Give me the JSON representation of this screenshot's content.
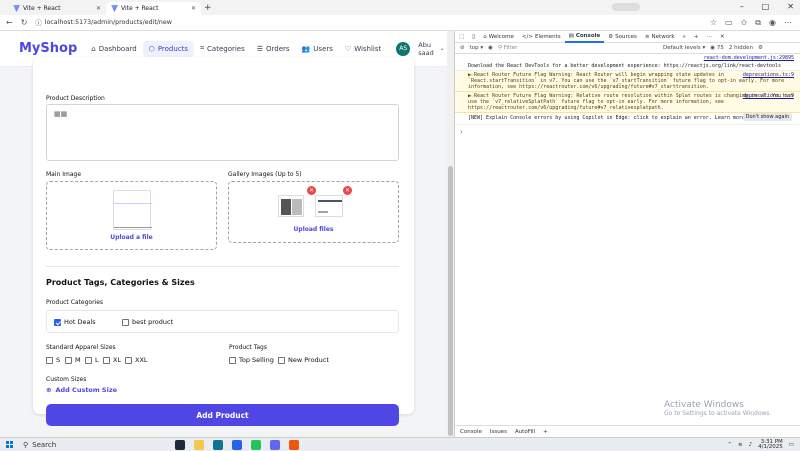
{
  "browser": {
    "tabs": [
      {
        "label": "Vite + React"
      },
      {
        "label": "Vite + React"
      }
    ],
    "url": "localhost:5173/admin/products/edit/new"
  },
  "app": {
    "brand": "MyShop",
    "nav": [
      "Dashboard",
      "Products",
      "Categories",
      "Orders",
      "Users",
      "Wishlist"
    ],
    "user": {
      "initials": "AS",
      "name_line1": "Abu",
      "name_line2": "saad"
    }
  },
  "form": {
    "description_label": "Product Description",
    "description_value": "▦▦",
    "main_image_label": "Main Image",
    "main_image_upload": "Upload a file",
    "gallery_label": "Gallery Images (Up to 5)",
    "gallery_upload": "Upload files",
    "section_title": "Product Tags, Categories & Sizes",
    "categories_label": "Product Categories",
    "categories": [
      {
        "label": "Hot Deals",
        "checked": true
      },
      {
        "label": "best product",
        "checked": false
      }
    ],
    "sizes_label": "Standard Apparel Sizes",
    "sizes": [
      "S",
      "M",
      "L",
      "XL",
      "XXL"
    ],
    "tags_label": "Product Tags",
    "tags": [
      "Top Selling",
      "New Product"
    ],
    "custom_sizes_label": "Custom Sizes",
    "add_custom_size": "Add Custom Size",
    "submit": "Add Product"
  },
  "devtools": {
    "tabs": [
      "Welcome",
      "Elements",
      "Console",
      "Sources",
      "Network"
    ],
    "context": "top",
    "filter_placeholder": "Filter",
    "levels": "Default levels",
    "issues": "75",
    "hidden": "2 hidden",
    "messages": [
      {
        "type": "info",
        "text": "Download the React DevTools for a better development experience: https://reactjs.org/link/react-devtools",
        "src": "react-dom.development.js:29895"
      },
      {
        "type": "warn",
        "text": "▶ React Router Future Flag Warning: React Router will begin wrapping state updates in `React.startTransition` in v7. You can use the `v7_startTransition` future flag to opt-in early. For more information, see https://reactrouter.com/v6/upgrading/future#v7_starttransition.",
        "src": "deprecations.ts:9"
      },
      {
        "type": "warn",
        "text": "▶ React Router Future Flag Warning: Relative route resolution within Splat routes is changing in v7. You can use the `v7_relativeSplatPath` future flag to opt-in early. For more information, see https://reactrouter.com/v6/upgrading/future#v7_relativesplatpath.",
        "src": "deprecations.ts:9"
      },
      {
        "type": "info",
        "text": "[NEW] Explain Console errors by using Copilot in Edge: click  to explain an error. Learn more",
        "action": "Don't show again"
      }
    ],
    "bottom_tabs": [
      "Console",
      "Issues",
      "AutoFill"
    ]
  },
  "watermark": {
    "line1": "Activate Windows",
    "line2": "Go to Settings to activate Windows."
  },
  "taskbar": {
    "search": "Search",
    "time": "3:31 PM",
    "date": "4/1/2025"
  }
}
